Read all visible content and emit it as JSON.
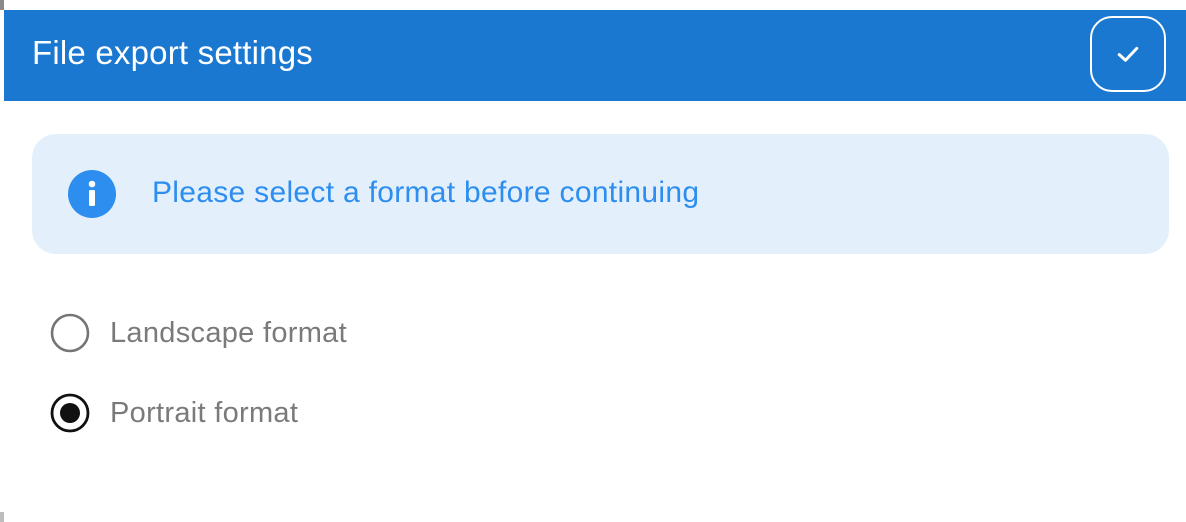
{
  "dialog": {
    "title": "File export settings",
    "confirm_icon": "check-icon"
  },
  "banner": {
    "icon": "info-icon",
    "message": "Please select a format before continuing"
  },
  "options": [
    {
      "label": "Landscape format",
      "selected": false
    },
    {
      "label": "Portrait format",
      "selected": true
    }
  ],
  "colors": {
    "header": "#1b78d0",
    "banner_bg": "#e3f0fc",
    "banner_text": "#2d8ef0",
    "option_text": "#7a7a7a"
  }
}
